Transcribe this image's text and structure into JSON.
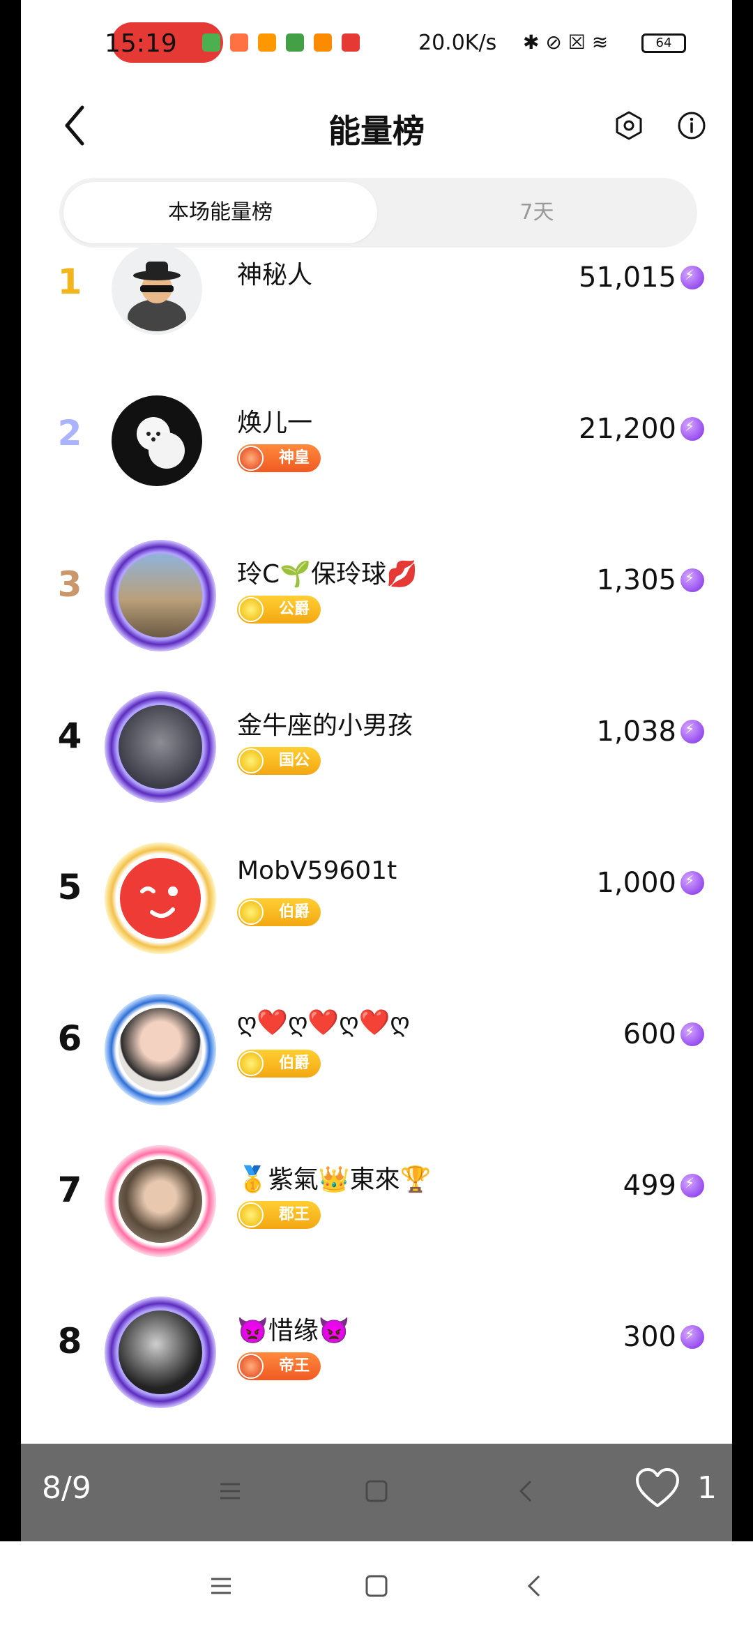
{
  "status_bar": {
    "time": "15:19",
    "network_speed": "20.0K/s",
    "battery": "64"
  },
  "header": {
    "title": "能量榜",
    "back_icon": "chevron-left-icon",
    "settings_icon": "hexagon-settings-icon",
    "info_icon": "info-circle-icon"
  },
  "tabs": [
    {
      "label": "本场能量榜",
      "active": true
    },
    {
      "label": "7天",
      "active": false
    }
  ],
  "leaderboard": [
    {
      "rank": "1",
      "name": "神秘人",
      "score": "51,015",
      "badge": "",
      "avatar_theme": "mystery"
    },
    {
      "rank": "2",
      "name": "焕儿一",
      "score": "21,200",
      "badge": "神皇",
      "avatar_theme": "dog"
    },
    {
      "rank": "3",
      "name": "玲C🌱保玲球💋",
      "score": "1,305",
      "badge": "公爵",
      "avatar_theme": "purple-frame"
    },
    {
      "rank": "4",
      "name": "金牛座的小男孩",
      "score": "1,038",
      "badge": "国公",
      "avatar_theme": "purple-frame"
    },
    {
      "rank": "5",
      "name": "MobV59601t",
      "score": "1,000",
      "badge": "伯爵",
      "avatar_theme": "gold-frame"
    },
    {
      "rank": "6",
      "name": "ღ❤️ღ❤️ღ❤️ღ",
      "score": "600",
      "badge": "伯爵",
      "avatar_theme": "blue-frame"
    },
    {
      "rank": "7",
      "name": "🥇紫氣👑東來🏆",
      "score": "499",
      "badge": "郡王",
      "avatar_theme": "pink-frame"
    },
    {
      "rank": "8",
      "name": "👿惜缘👿",
      "score": "300",
      "badge": "帝王",
      "avatar_theme": "purple-frame"
    }
  ],
  "gallery_overlay": {
    "counter": "8/9",
    "like_count": "1",
    "like_icon": "heart-outline-icon"
  },
  "system_nav": {
    "menu_icon": "menu-icon",
    "home_icon": "home-square-icon",
    "back_icon": "back-chevron-icon"
  },
  "colors": {
    "rank1": "#f2b51c",
    "rank2": "#a9b3ff",
    "rank3": "#c9976a",
    "energy": "#7d2ae8",
    "badge_gold": "#f3a712",
    "badge_red": "#f05a22"
  }
}
